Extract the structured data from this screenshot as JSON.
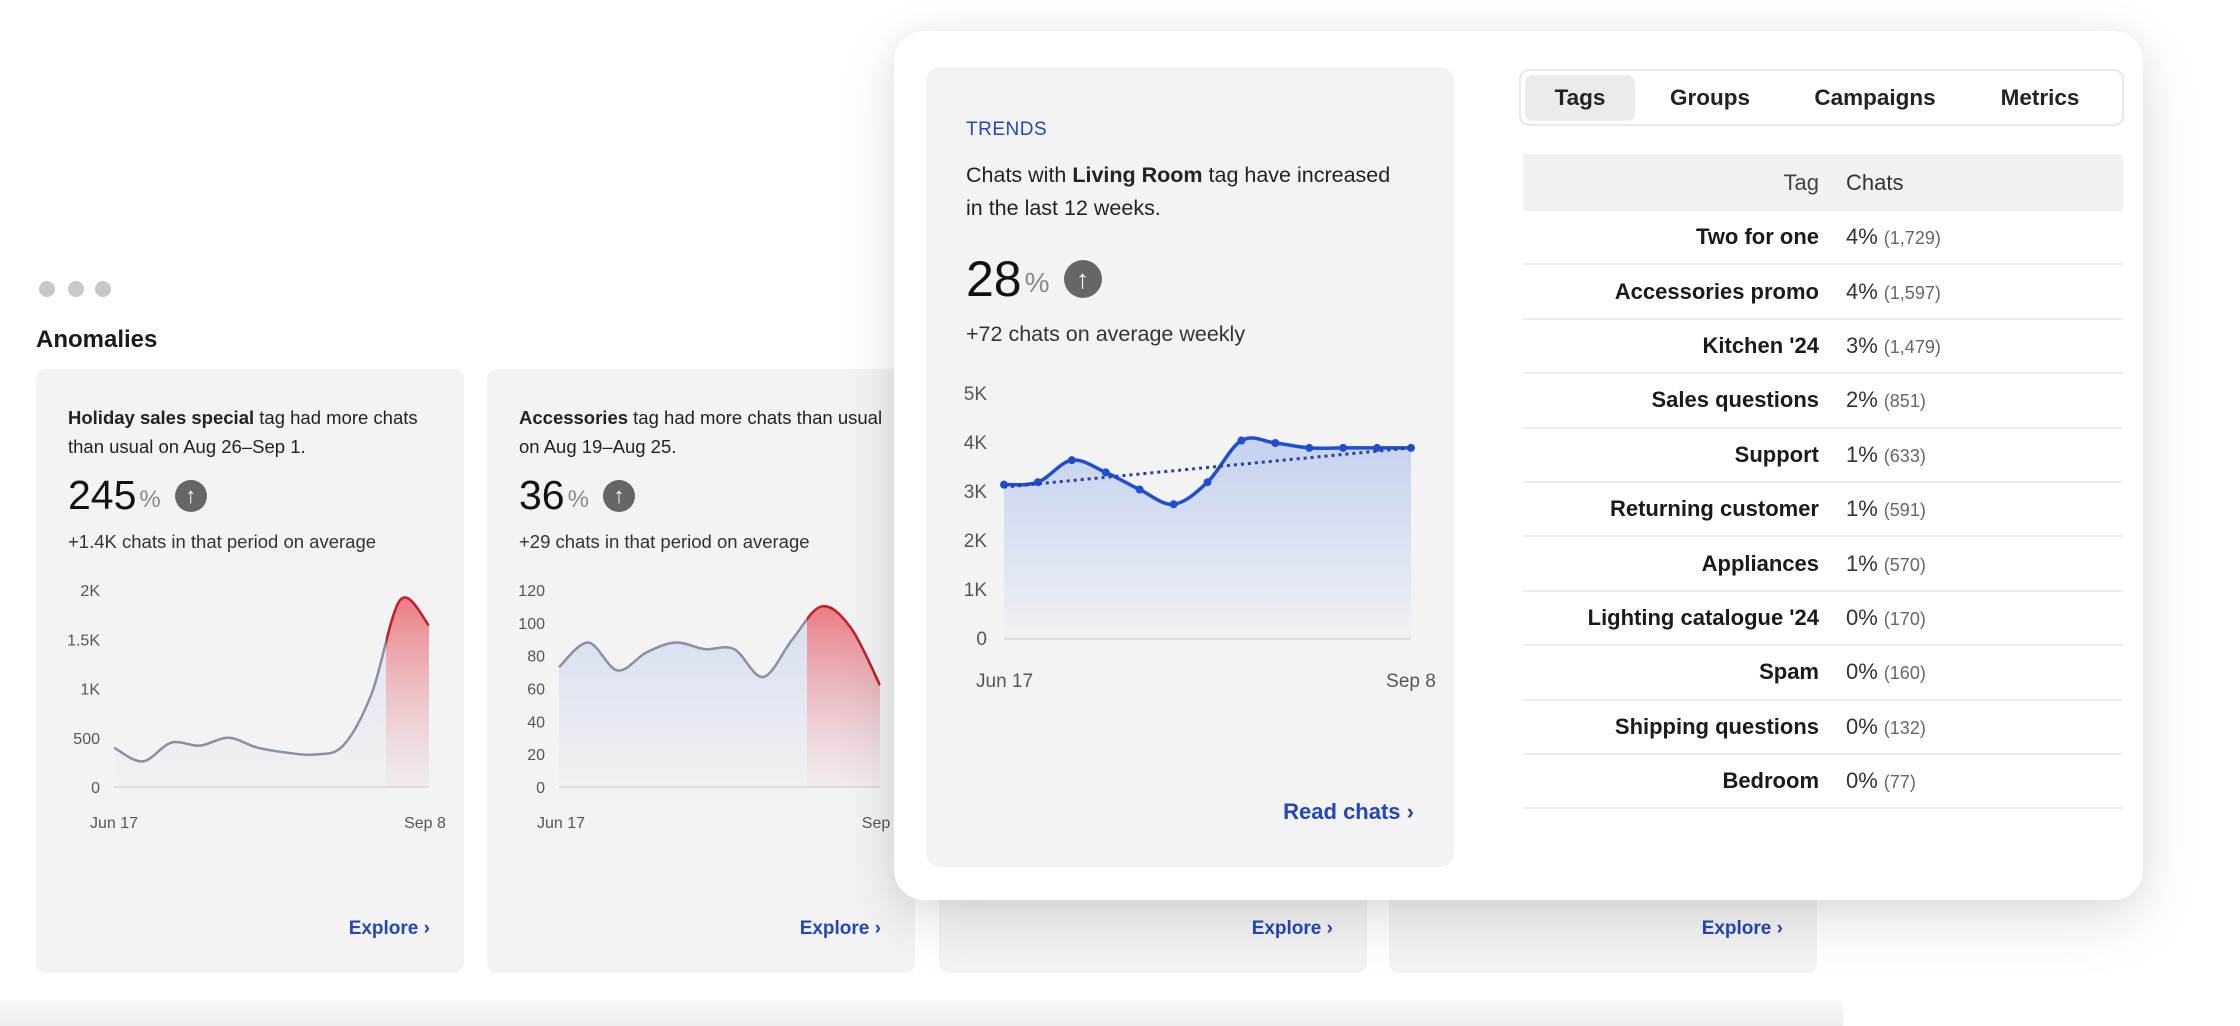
{
  "section_title": "Anomalies",
  "anomalies": [
    {
      "tag": "Holiday sales special",
      "desc_rest": " tag had more chats than usual on Aug 26–Sep 1.",
      "value": "245",
      "unit": "%",
      "sub": "+1.4K chats in that period on average",
      "explore": "Explore"
    },
    {
      "tag": "Accessories",
      "desc_rest": " tag had more chats than usual on Aug 19–Aug 25.",
      "value": "36",
      "unit": "%",
      "sub": "+29 chats in that period on average",
      "explore": "Explore"
    },
    {
      "explore": "Explore"
    },
    {
      "explore": "Explore"
    }
  ],
  "trends": {
    "label": "TRENDS",
    "desc_pre": "Chats with ",
    "tag": "Living Room",
    "desc_post": " tag have increased in the last 12 weeks.",
    "value": "28",
    "unit": "%",
    "sub": "+72 chats on average weekly",
    "read_chats": "Read chats"
  },
  "tabs": [
    {
      "label": "Tags",
      "active": true
    },
    {
      "label": "Groups"
    },
    {
      "label": "Campaigns"
    },
    {
      "label": "Metrics"
    }
  ],
  "table": {
    "headers": {
      "tag": "Tag",
      "chats": "Chats"
    },
    "rows": [
      {
        "tag": "Two for one",
        "pct": "4%",
        "count": "(1,729)"
      },
      {
        "tag": "Accessories promo",
        "pct": "4%",
        "count": "(1,597)"
      },
      {
        "tag": "Kitchen '24",
        "pct": "3%",
        "count": "(1,479)"
      },
      {
        "tag": "Sales questions",
        "pct": "2%",
        "count": "(851)"
      },
      {
        "tag": "Support",
        "pct": "1%",
        "count": "(633)"
      },
      {
        "tag": "Returning customer",
        "pct": "1%",
        "count": "(591)"
      },
      {
        "tag": "Appliances",
        "pct": "1%",
        "count": "(570)"
      },
      {
        "tag": "Lighting catalogue '24",
        "pct": "0%",
        "count": "(170)"
      },
      {
        "tag": "Spam",
        "pct": "0%",
        "count": "(160)"
      },
      {
        "tag": "Shipping questions",
        "pct": "0%",
        "count": "(132)"
      },
      {
        "tag": "Bedroom",
        "pct": "0%",
        "count": "(77)"
      }
    ]
  },
  "colors": {
    "accent": "#2546b8",
    "anomaly": "#c0202a",
    "line": "#8a8fa3",
    "trend_line": "#1f4fd1"
  },
  "chart_data": [
    {
      "type": "area",
      "x_labels": [
        "Jun 17",
        "Sep 8"
      ],
      "y_ticks": [
        "0",
        "500",
        "1K",
        "1.5K",
        "2K"
      ],
      "ylim": [
        0,
        2000
      ],
      "values": [
        400,
        260,
        450,
        420,
        500,
        400,
        350,
        330,
        420,
        950,
        1900,
        1640
      ],
      "highlight_from_index": 10,
      "highlight_to_index": 11
    },
    {
      "type": "area",
      "x_labels": [
        "Jun 17",
        "Sep"
      ],
      "y_ticks": [
        "0",
        "20",
        "40",
        "60",
        "80",
        "100",
        "120"
      ],
      "ylim": [
        0,
        120
      ],
      "values": [
        73,
        88,
        71,
        82,
        88,
        84,
        84,
        67,
        90,
        110,
        97,
        62
      ],
      "highlight_from_index": 9,
      "highlight_to_index": 11
    },
    {
      "type": "line",
      "x_labels": [
        "Jun 17",
        "Sep 8"
      ],
      "y_ticks": [
        "0",
        "1K",
        "2K",
        "3K",
        "4K",
        "5K"
      ],
      "ylim": [
        0,
        5000
      ],
      "values": [
        3150,
        3200,
        3650,
        3400,
        3050,
        2750,
        3200,
        4050,
        4000,
        3900,
        3900,
        3900,
        3900
      ],
      "trendline": [
        3100,
        3900
      ]
    }
  ]
}
